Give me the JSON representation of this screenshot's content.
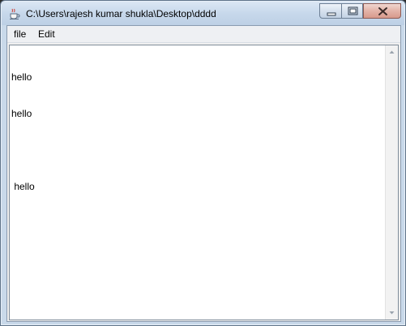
{
  "window": {
    "title": "C:\\Users\\rajesh kumar shukla\\Desktop\\dddd"
  },
  "menu": {
    "items": [
      {
        "label": "file"
      },
      {
        "label": "Edit"
      }
    ]
  },
  "editor": {
    "lines": [
      "hello",
      "hello",
      "",
      " hello"
    ]
  },
  "icons": {
    "app": "java-cup-icon",
    "minimize": "minimize-icon",
    "maximize": "maximize-icon",
    "close": "close-icon"
  },
  "colors": {
    "titlebar": "#c7d8eb",
    "close_button": "#d79a8c",
    "text_area": "#ffffff"
  }
}
